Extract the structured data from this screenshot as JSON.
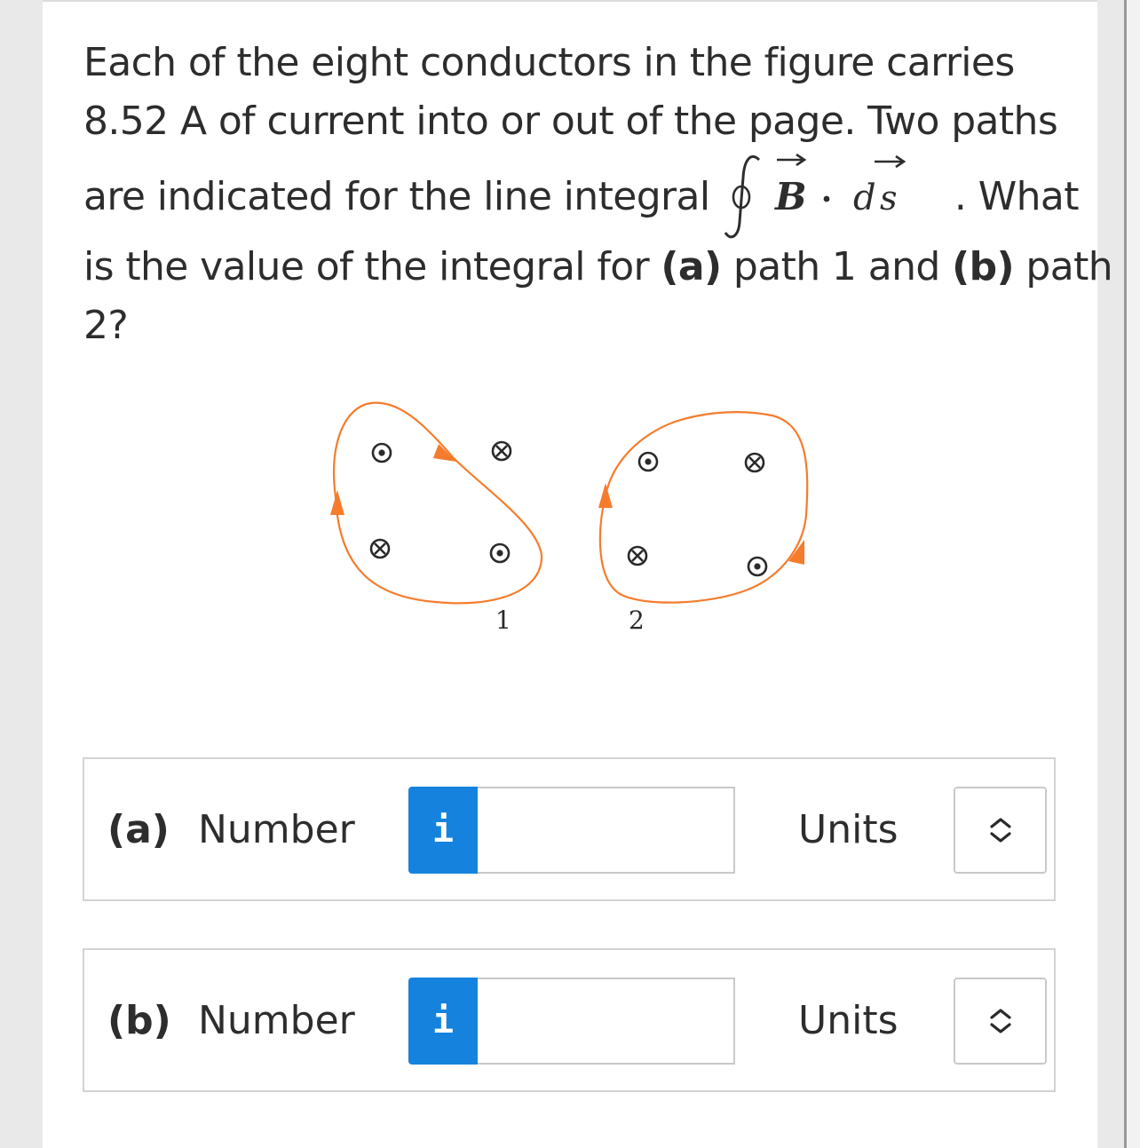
{
  "question": {
    "line1": "Each of the eight conductors in the figure carries",
    "line2": "8.52 A of current into or out of the page. Two paths",
    "line3_before": "are indicated for the line integral",
    "line3_after": ". What",
    "line4_start": "is the value of the integral for ",
    "line4_a": "(a)",
    "line4_mid": " path 1 and ",
    "line4_b": "(b)",
    "line4_end": " path",
    "line5": "2?",
    "math_B": "B",
    "math_d": "d",
    "math_s": "s"
  },
  "figure": {
    "path_label_1": "1",
    "path_label_2": "2",
    "path_color": "#f57c2c",
    "conductor_color": "#2a2a2a"
  },
  "part_a": {
    "label": "(a)",
    "number_label": "Number",
    "info_glyph": "i",
    "number_value": "",
    "units_label": "Units"
  },
  "part_b": {
    "label": "(b)",
    "number_label": "Number",
    "info_glyph": "i",
    "number_value": "",
    "units_label": "Units"
  },
  "colors": {
    "info_button": "#1583dd",
    "border": "#d3d3d3",
    "text": "#2d2d2d"
  }
}
